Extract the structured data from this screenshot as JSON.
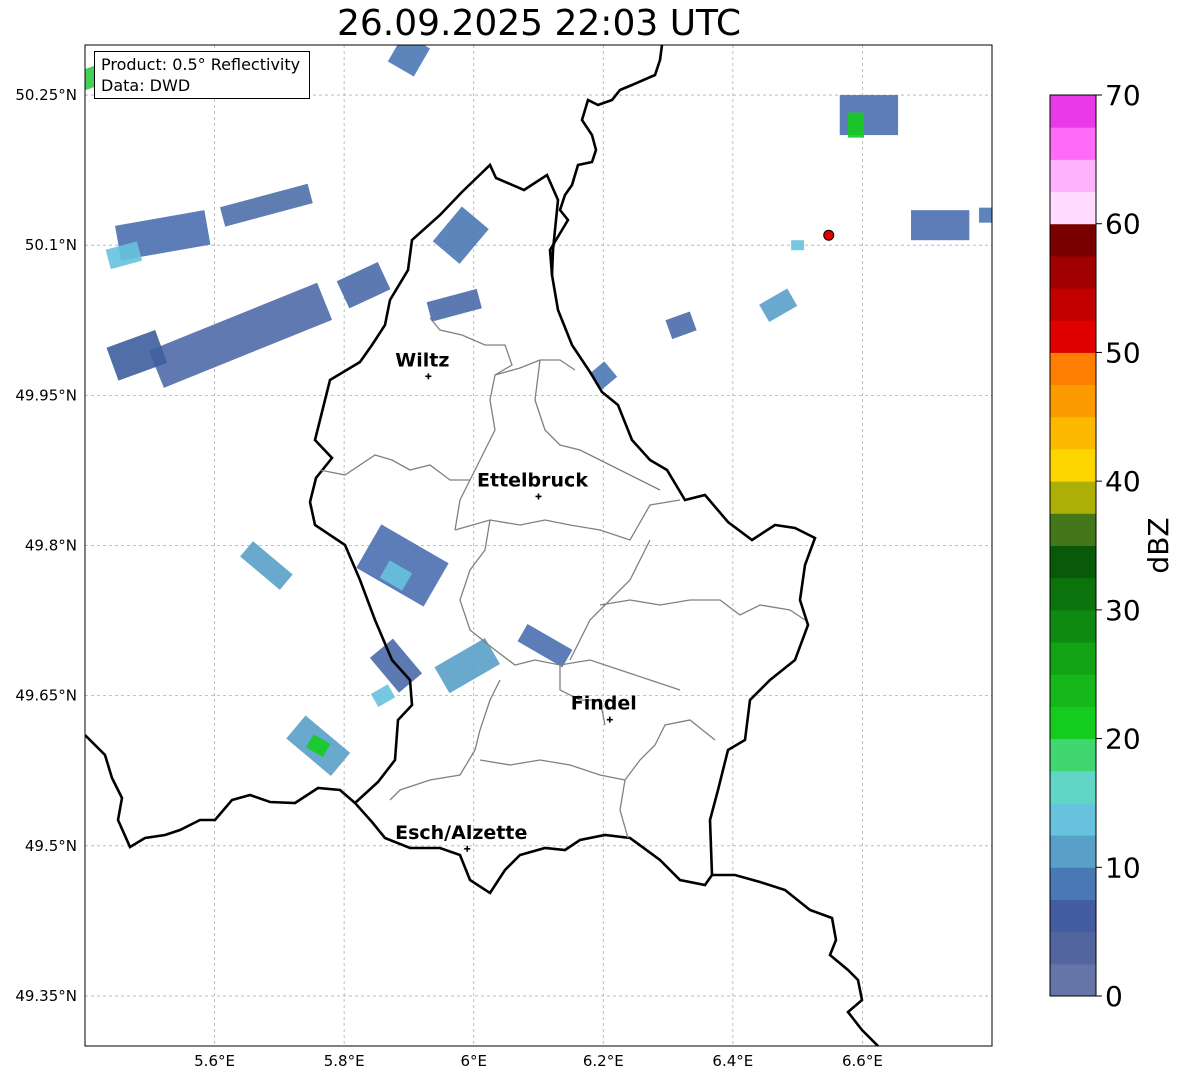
{
  "title": "26.09.2025 22:03 UTC",
  "info": {
    "product": "Product: 0.5° Reflectivity",
    "data": "Data: DWD"
  },
  "map": {
    "lon_range": [
      5.4,
      6.8
    ],
    "lat_range": [
      49.3,
      50.3
    ],
    "lon_ticks": [
      {
        "value": 5.6,
        "label": "5.6°E"
      },
      {
        "value": 5.8,
        "label": "5.8°E"
      },
      {
        "value": 6.0,
        "label": "6°E"
      },
      {
        "value": 6.2,
        "label": "6.2°E"
      },
      {
        "value": 6.4,
        "label": "6.4°E"
      },
      {
        "value": 6.6,
        "label": "6.6°E"
      }
    ],
    "lat_ticks": [
      {
        "value": 49.35,
        "label": "49.35°N"
      },
      {
        "value": 49.5,
        "label": "49.5°N"
      },
      {
        "value": 49.65,
        "label": "49.65°N"
      },
      {
        "value": 49.8,
        "label": "49.8°N"
      },
      {
        "value": 49.95,
        "label": "49.95°N"
      },
      {
        "value": 50.1,
        "label": "50.1°N"
      },
      {
        "value": 50.25,
        "label": "50.25°N"
      }
    ],
    "cities": [
      {
        "name": "Wiltz",
        "lon": 5.93,
        "lat": 49.969
      },
      {
        "name": "Ettelbruck",
        "lon": 6.1,
        "lat": 49.849
      },
      {
        "name": "Findel",
        "lon": 6.21,
        "lat": 49.626
      },
      {
        "name": "Esch/Alzette",
        "lon": 5.99,
        "lat": 49.497
      }
    ],
    "radar_site": {
      "lon": 6.548,
      "lat": 50.11,
      "color": "#e00000"
    }
  },
  "colorbar": {
    "label": "dBZ",
    "min": 0,
    "max": 70,
    "step": 2.5,
    "ticks": [
      {
        "value": 0,
        "label": "0"
      },
      {
        "value": 10,
        "label": "10"
      },
      {
        "value": 20,
        "label": "20"
      },
      {
        "value": 30,
        "label": "30"
      },
      {
        "value": 40,
        "label": "40"
      },
      {
        "value": 50,
        "label": "50"
      },
      {
        "value": 60,
        "label": "60"
      },
      {
        "value": 70,
        "label": "70"
      }
    ],
    "colors": [
      "#6575a8",
      "#53659e",
      "#435ea0",
      "#4a78b5",
      "#58a0c8",
      "#66c2dd",
      "#61d6c6",
      "#40d670",
      "#14cc1e",
      "#14b81a",
      "#12a314",
      "#0e8a10",
      "#0b720c",
      "#085a08",
      "#44761a",
      "#adaf07",
      "#fdd600",
      "#fdb800",
      "#fd9a00",
      "#fd7e00",
      "#e00000",
      "#c20000",
      "#a00000",
      "#7a0000",
      "#ffdcff",
      "#ffb3ff",
      "#ff6af6",
      "#e93ae8"
    ]
  },
  "echoes": [
    {
      "lon": 5.42,
      "lat": 50.27,
      "w": 0.07,
      "h": 0.02,
      "angle": -20,
      "color": "#2ecc40"
    },
    {
      "lon": 5.9,
      "lat": 50.29,
      "w": 0.05,
      "h": 0.03,
      "angle": -60,
      "color": "#4a78b5"
    },
    {
      "lon": 5.52,
      "lat": 50.11,
      "w": 0.14,
      "h": 0.035,
      "angle": -10,
      "color": "#4a6fb0"
    },
    {
      "lon": 5.46,
      "lat": 50.09,
      "w": 0.05,
      "h": 0.02,
      "angle": -15,
      "color": "#66c2dd"
    },
    {
      "lon": 5.68,
      "lat": 50.14,
      "w": 0.14,
      "h": 0.02,
      "angle": -15,
      "color": "#4f6fa8"
    },
    {
      "lon": 5.64,
      "lat": 50.01,
      "w": 0.28,
      "h": 0.04,
      "angle": -22,
      "color": "#4f6aa8"
    },
    {
      "lon": 5.48,
      "lat": 49.99,
      "w": 0.08,
      "h": 0.035,
      "angle": -20,
      "color": "#3f5ea0"
    },
    {
      "lon": 5.83,
      "lat": 50.06,
      "w": 0.07,
      "h": 0.03,
      "angle": -25,
      "color": "#4a6aa8"
    },
    {
      "lon": 5.98,
      "lat": 50.11,
      "w": 0.07,
      "h": 0.035,
      "angle": -50,
      "color": "#4a78b5"
    },
    {
      "lon": 5.97,
      "lat": 50.04,
      "w": 0.08,
      "h": 0.02,
      "angle": -15,
      "color": "#4a6aa8"
    },
    {
      "lon": 5.68,
      "lat": 49.78,
      "w": 0.08,
      "h": 0.02,
      "angle": 40,
      "color": "#58a0c8"
    },
    {
      "lon": 5.89,
      "lat": 49.78,
      "w": 0.12,
      "h": 0.05,
      "angle": 30,
      "color": "#4a6fb0"
    },
    {
      "lon": 5.88,
      "lat": 49.77,
      "w": 0.04,
      "h": 0.02,
      "angle": 30,
      "color": "#66c2dd"
    },
    {
      "lon": 5.88,
      "lat": 49.68,
      "w": 0.07,
      "h": 0.03,
      "angle": 50,
      "color": "#4a6aa8"
    },
    {
      "lon": 5.99,
      "lat": 49.68,
      "w": 0.09,
      "h": 0.03,
      "angle": -30,
      "color": "#58a0c8"
    },
    {
      "lon": 5.86,
      "lat": 49.65,
      "w": 0.03,
      "h": 0.015,
      "angle": -30,
      "color": "#66c2dd"
    },
    {
      "lon": 6.11,
      "lat": 49.7,
      "w": 0.08,
      "h": 0.02,
      "angle": 30,
      "color": "#4a6fb0"
    },
    {
      "lon": 5.76,
      "lat": 49.6,
      "w": 0.09,
      "h": 0.03,
      "angle": 40,
      "color": "#58a0c8"
    },
    {
      "lon": 5.76,
      "lat": 49.6,
      "w": 0.03,
      "h": 0.015,
      "angle": 30,
      "color": "#14cc1e"
    },
    {
      "lon": 6.2,
      "lat": 49.97,
      "w": 0.03,
      "h": 0.02,
      "angle": -40,
      "color": "#4a78b5"
    },
    {
      "lon": 6.61,
      "lat": 50.23,
      "w": 0.09,
      "h": 0.04,
      "angle": 0,
      "color": "#4a6fb0"
    },
    {
      "lon": 6.59,
      "lat": 50.22,
      "w": 0.025,
      "h": 0.025,
      "angle": 0,
      "color": "#14cc1e"
    },
    {
      "lon": 6.32,
      "lat": 50.02,
      "w": 0.04,
      "h": 0.02,
      "angle": -20,
      "color": "#4a6aa8"
    },
    {
      "lon": 6.47,
      "lat": 50.04,
      "w": 0.05,
      "h": 0.02,
      "angle": -30,
      "color": "#58a0c8"
    },
    {
      "lon": 6.72,
      "lat": 50.12,
      "w": 0.09,
      "h": 0.03,
      "angle": 0,
      "color": "#4a6fb0"
    },
    {
      "lon": 6.79,
      "lat": 50.13,
      "w": 0.02,
      "h": 0.015,
      "angle": 0,
      "color": "#4a78b5"
    },
    {
      "lon": 6.5,
      "lat": 50.1,
      "w": 0.02,
      "h": 0.01,
      "angle": 0,
      "color": "#66c2dd"
    }
  ]
}
